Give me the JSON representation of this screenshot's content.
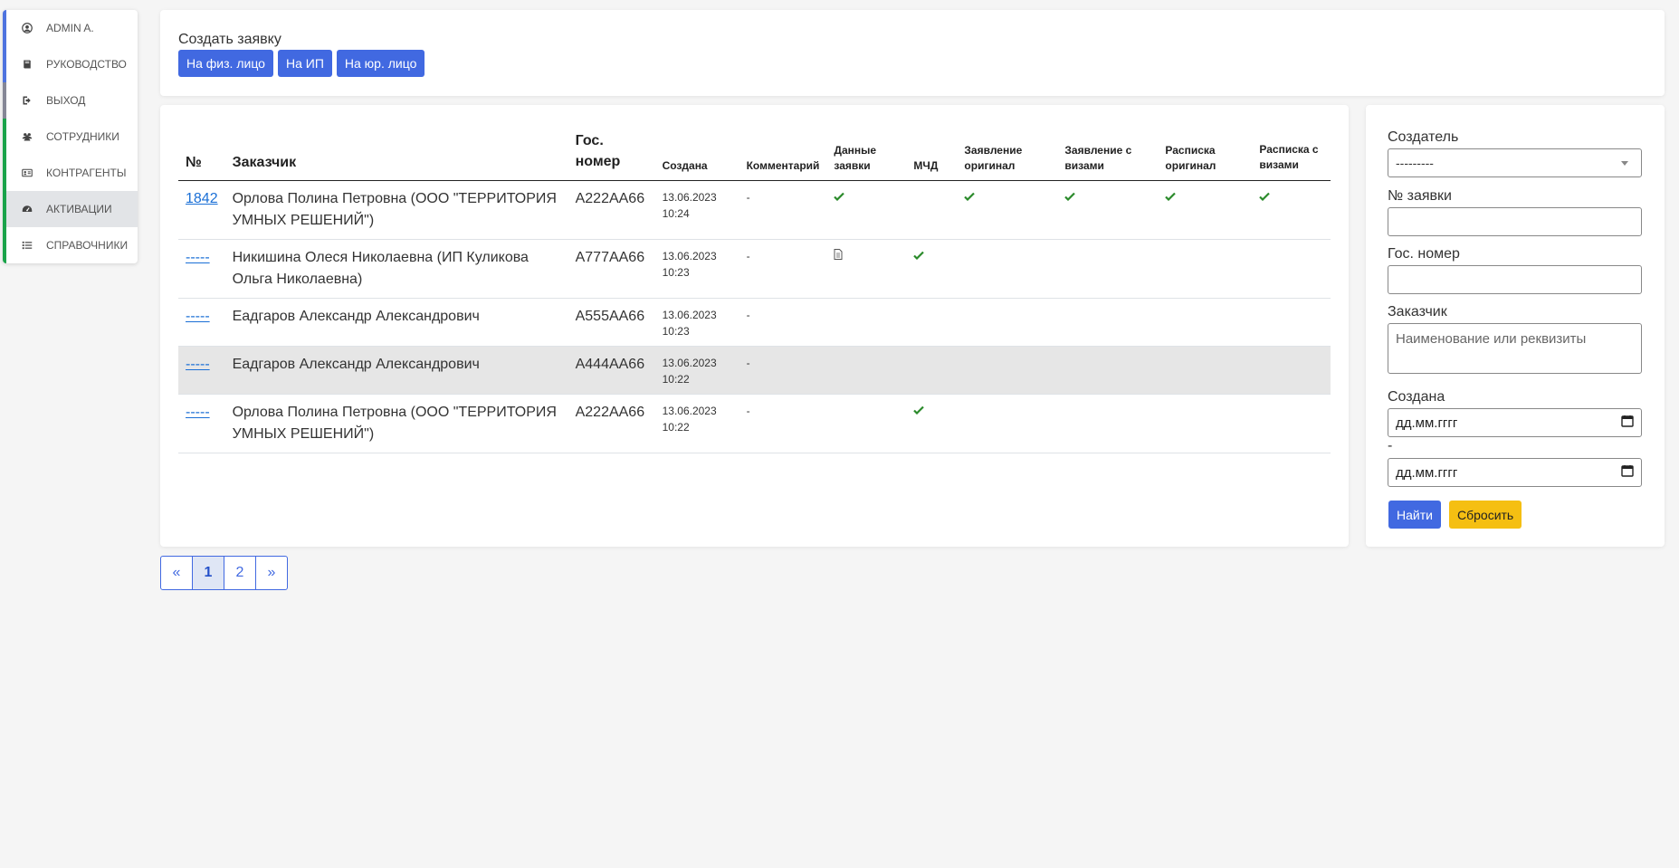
{
  "sidebar": {
    "items": [
      {
        "label": "Admin A.",
        "icon": "user-circle-icon"
      },
      {
        "label": "Руководство",
        "icon": "book-icon"
      },
      {
        "label": "Выход",
        "icon": "sign-out-icon"
      },
      {
        "label": "Сотрудники",
        "icon": "users-icon"
      },
      {
        "label": "Контрагенты",
        "icon": "id-card-icon"
      },
      {
        "label": "Активации",
        "icon": "dashboard-icon"
      },
      {
        "label": "Справочники",
        "icon": "list-icon"
      }
    ]
  },
  "create": {
    "label": "Создать заявку",
    "buttons": [
      "На физ. лицо",
      "На ИП",
      "На юр. лицо"
    ]
  },
  "table": {
    "headers": {
      "num": "№",
      "customer": "Заказчик",
      "plate": "Гос. номер",
      "created": "Создана",
      "comment": "Комментарий",
      "data": "Данные заявки",
      "mcd": "МЧД",
      "app_orig": "Заявление оригинал",
      "app_visa": "Заявление с визами",
      "receipt_orig": "Расписка оригинал",
      "receipt_visa": "Расписка с визами"
    },
    "rows": [
      {
        "num": "1842",
        "customer": "Орлова Полина Петровна (ООО \"ТЕРРИТОРИЯ УМНЫХ РЕШЕНИЙ\")",
        "plate": "А222АА66",
        "date": "13.06.2023",
        "time": "10:24",
        "comment": "-"
      },
      {
        "num": "-----",
        "customer": "Никишина Олеся Николаевна (ИП Куликова Ольга Николаевна)",
        "plate": "А777АА66",
        "date": "13.06.2023",
        "time": "10:23",
        "comment": "-"
      },
      {
        "num": "-----",
        "customer": "Еадгаров Александр Александрович",
        "plate": "А555АА66",
        "date": "13.06.2023",
        "time": "10:23",
        "comment": "-"
      },
      {
        "num": "-----",
        "customer": "Еадгаров Александр Александрович",
        "plate": "А444АА66",
        "date": "13.06.2023",
        "time": "10:22",
        "comment": "-"
      },
      {
        "num": "-----",
        "customer": "Орлова Полина Петровна (ООО \"ТЕРРИТОРИЯ УМНЫХ РЕШЕНИЙ\")",
        "plate": "А222АА66",
        "date": "13.06.2023",
        "time": "10:22",
        "comment": "-"
      }
    ]
  },
  "pagination": {
    "prev": "«",
    "pages": [
      "1",
      "2"
    ],
    "next": "»",
    "current": "1"
  },
  "filter": {
    "creator_label": "Создатель",
    "creator_value": "---------",
    "number_label": "№ заявки",
    "plate_label": "Гос. номер",
    "customer_label": "Заказчик",
    "customer_placeholder": "Наименование или реквизиты",
    "created_label": "Создана",
    "date_from": "дд.мм.гггг",
    "dash": "-",
    "date_to": "дд.мм.гггг",
    "find": "Найти",
    "reset": "Сбросить"
  },
  "colors": {
    "primary": "#4169e1",
    "warning": "#f5bf12",
    "success": "#2a8a2a",
    "sidebar_blue": "#4e73df",
    "sidebar_green": "#1aa34a"
  }
}
